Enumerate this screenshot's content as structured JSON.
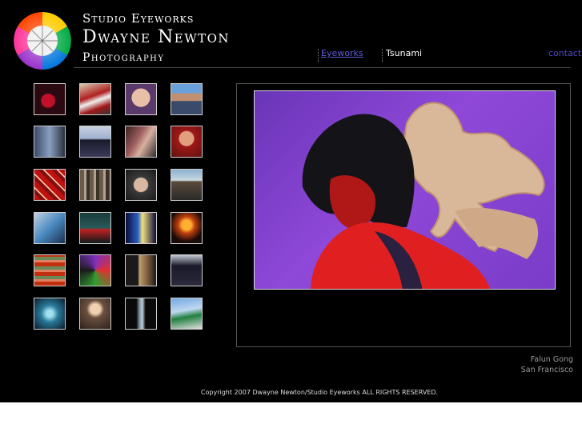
{
  "brand": {
    "line1": "Studio Eyeworks",
    "line2": "Dwayne Newton",
    "line3": "Photography"
  },
  "nav": {
    "eyeworks": "Eyeworks",
    "tsunami": "Tsunami",
    "contact": "contact"
  },
  "photo": {
    "caption_line1": "Falun Gong",
    "caption_line2": "San Francisco"
  },
  "footer": {
    "copyright": "Copyright 2007 Dwayne Newton/Studio Eyeworks  ALL RIGHTS RESERVED."
  },
  "colors": {
    "background": "#000000",
    "link": "#5b5bd8",
    "text": "#ffffff"
  }
}
